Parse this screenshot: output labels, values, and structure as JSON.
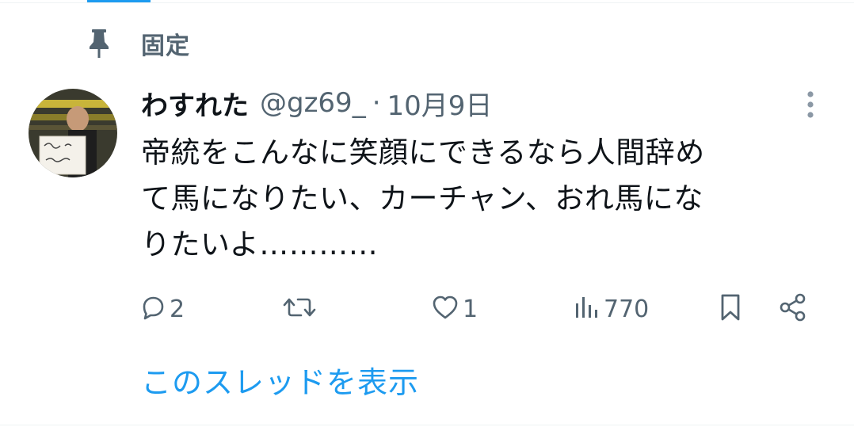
{
  "pinned": {
    "label": "固定",
    "icon": "pin-icon"
  },
  "tweet": {
    "display_name": "わすれた",
    "handle": "@gz69_",
    "separator": "·",
    "date": "10月9日",
    "lines": [
      "帝統をこんなに笑顔にできるなら人間辞め",
      "て馬になりたい、カーチャン、おれ馬にな",
      "りたいよ…………"
    ],
    "more_icon": "more-vertical-icon"
  },
  "actions": {
    "reply_count": "2",
    "retweet_count": "",
    "like_count": "1",
    "views_count": "770"
  },
  "show_thread": "このスレッドを表示",
  "colors": {
    "accent": "#1d9bf0",
    "secondary_text": "#536471",
    "primary_text": "#0f1419"
  }
}
